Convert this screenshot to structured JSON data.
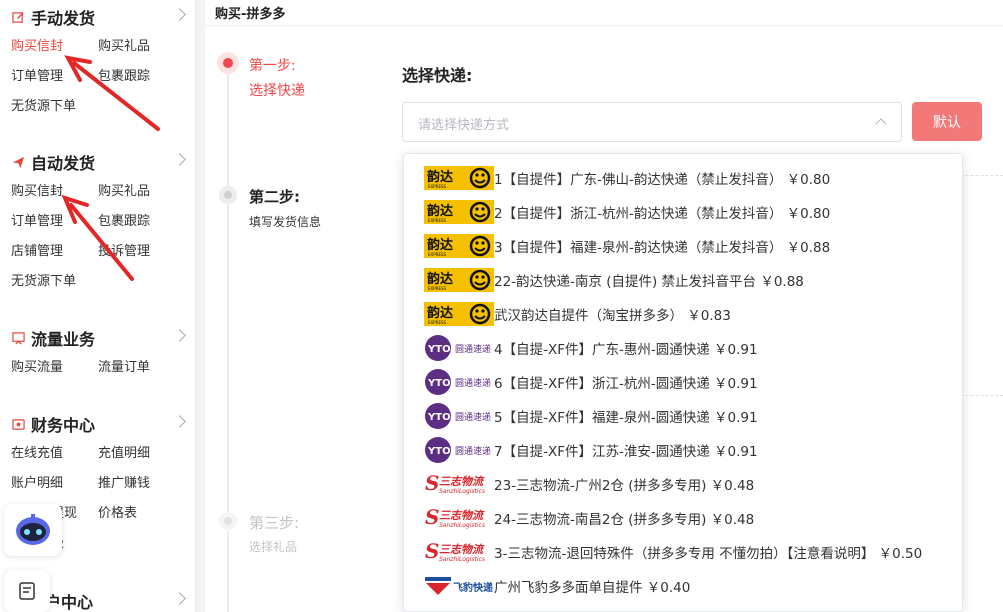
{
  "sidebar": {
    "sections": [
      {
        "title": "手动发货",
        "icon": "edit-icon",
        "items": [
          "购买信封",
          "购买礼品",
          "订单管理",
          "包裹跟踪",
          "无货源下单"
        ],
        "active": 0
      },
      {
        "title": "自动发货",
        "icon": "send-icon",
        "items": [
          "购买信封",
          "购买礼品",
          "订单管理",
          "包裹跟踪",
          "店铺管理",
          "投诉管理",
          "无货源下单"
        ]
      },
      {
        "title": "流量业务",
        "icon": "flow-icon",
        "items": [
          "购买流量",
          "流量订单"
        ]
      },
      {
        "title": "财务中心",
        "icon": "finance-icon",
        "items": [
          "在线充值",
          "充值明细",
          "账户明细",
          "推广赚钱",
          "提现",
          "价格表",
          "级"
        ]
      },
      {
        "title": "户中心",
        "icon": "user-icon",
        "items": []
      }
    ]
  },
  "breadcrumb": "购买-拼多多",
  "steps": [
    {
      "title": "第一步:",
      "sub": "选择快递",
      "state": "active"
    },
    {
      "title": "第二步:",
      "sub": "填写发货信息",
      "state": "normal"
    },
    {
      "title": "第三步:",
      "sub": "选择礼品",
      "state": "disabled"
    }
  ],
  "form": {
    "label": "选择快递:",
    "placeholder": "请选择快递方式",
    "default_button": "默认"
  },
  "options": [
    {
      "brand": "yunda",
      "text": "1【自提件】广东-佛山-韵达快递（禁止发抖音） ￥0.80"
    },
    {
      "brand": "yunda",
      "text": "2【自提件】浙江-杭州-韵达快递（禁止发抖音） ￥0.80"
    },
    {
      "brand": "yunda",
      "text": "3【自提件】福建-泉州-韵达快递（禁止发抖音） ￥0.88"
    },
    {
      "brand": "yunda",
      "text": "22-韵达快递-南京 (自提件) 禁止发抖音平台 ￥0.88"
    },
    {
      "brand": "yunda",
      "text": "武汉韵达自提件（淘宝拼多多） ￥0.83"
    },
    {
      "brand": "yto",
      "text": "4【自提-XF件】广东-惠州-圆通快递 ￥0.91"
    },
    {
      "brand": "yto",
      "text": "6【自提-XF件】浙江-杭州-圆通快递 ￥0.91"
    },
    {
      "brand": "yto",
      "text": "5【自提-XF件】福建-泉州-圆通快递 ￥0.91"
    },
    {
      "brand": "yto",
      "text": "7【自提-XF件】江苏-淮安-圆通快递 ￥0.91"
    },
    {
      "brand": "sanzhi",
      "text": "23-三志物流-广州2仓 (拼多多专用) ￥0.48"
    },
    {
      "brand": "sanzhi",
      "text": "24-三志物流-南昌2仓 (拼多多专用) ￥0.48"
    },
    {
      "brand": "sanzhi",
      "text": "3-三志物流-退回特殊件（拼多多专用 不懂勿拍）【注意看说明】 ￥0.50"
    },
    {
      "brand": "feibao",
      "text": "广州飞豹多多面单自提件 ￥0.40"
    }
  ],
  "logos": {
    "yunda": {
      "label": "韵达",
      "sub": "EXPRESS"
    },
    "yto": {
      "label": "圆通速递"
    },
    "sanzhi": {
      "label": "三志物流",
      "sub": "SanzhiLogistics"
    },
    "feibao": {
      "label": "飞豹快递"
    }
  },
  "colors": {
    "accent": "#e8453c",
    "button": "#f37878",
    "yunda": "#f5c000",
    "yto": "#5b2d83",
    "sanzhi": "#d9262c",
    "feibao": "#1d4fa0"
  }
}
